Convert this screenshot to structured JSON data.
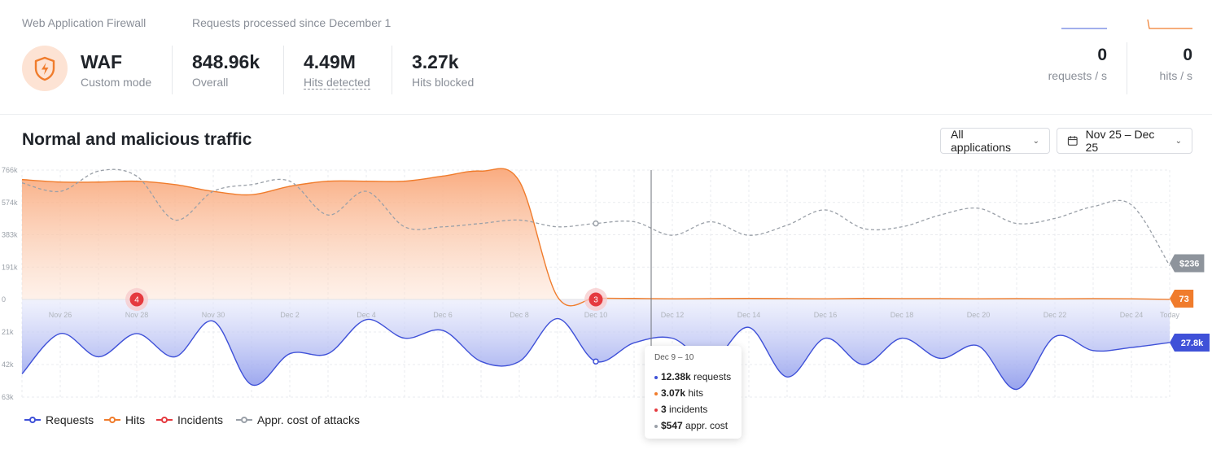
{
  "header": {
    "app_label": "Web Application Firewall",
    "since_label": "Requests processed since December 1",
    "waf_title": "WAF",
    "waf_mode": "Custom mode",
    "stats": [
      {
        "value": "848.96k",
        "label": "Overall"
      },
      {
        "value": "4.49M",
        "label": "Hits detected"
      },
      {
        "value": "3.27k",
        "label": "Hits blocked"
      }
    ],
    "live": [
      {
        "value": "0",
        "label": "requests / s"
      },
      {
        "value": "0",
        "label": "hits / s"
      }
    ]
  },
  "section": {
    "title": "Normal and malicious traffic",
    "app_filter": "All applications",
    "date_range": "Nov 25 – Dec 25"
  },
  "legend": [
    {
      "label": "Requests",
      "color": "#3f51d8"
    },
    {
      "label": "Hits",
      "color": "#f07c2c"
    },
    {
      "label": "Incidents",
      "color": "#e53a3f"
    },
    {
      "label": "Appr. cost of attacks",
      "color": "#9aa0a8"
    }
  ],
  "tooltip": {
    "title": "Dec 9 – 10",
    "rows": [
      {
        "bold": "12.38k",
        "text": " requests",
        "color": "#3f51d8"
      },
      {
        "bold": "3.07k",
        "text": " hits",
        "color": "#f07c2c"
      },
      {
        "bold": "3",
        "text": " incidents",
        "color": "#e53a3f"
      },
      {
        "bold": "$547",
        "text": " appr. cost",
        "color": "#9aa0a8"
      }
    ]
  },
  "chart_data": {
    "type": "area",
    "x": [
      "Nov 25",
      "Nov 26",
      "Nov 27",
      "Nov 28",
      "Nov 29",
      "Nov 30",
      "Dec 1",
      "Dec 2",
      "Dec 3",
      "Dec 4",
      "Dec 5",
      "Dec 6",
      "Dec 7",
      "Dec 8",
      "Dec 9",
      "Dec 10",
      "Dec 11",
      "Dec 12",
      "Dec 13",
      "Dec 14",
      "Dec 15",
      "Dec 16",
      "Dec 17",
      "Dec 18",
      "Dec 19",
      "Dec 20",
      "Dec 21",
      "Dec 22",
      "Dec 23",
      "Dec 24",
      "Dec 25"
    ],
    "x_tick_labels": [
      "Nov 26",
      "Nov 28",
      "Nov 30",
      "Dec 2",
      "Dec 4",
      "Dec 6",
      "Dec 8",
      "Dec 10",
      "Dec 12",
      "Dec 14",
      "Dec 16",
      "Dec 18",
      "Dec 20",
      "Dec 22",
      "Dec 24",
      "Today"
    ],
    "y_top_ticks": [
      "766k",
      "574k",
      "383k",
      "191k",
      "0"
    ],
    "y_bottom_ticks": [
      "21k",
      "42k",
      "63k"
    ],
    "top_ylim": [
      0,
      766000
    ],
    "bottom_ylim": [
      0,
      63000
    ],
    "series": [
      {
        "name": "Hits",
        "axis": "top",
        "values": [
          710000,
          695000,
          695000,
          700000,
          680000,
          640000,
          620000,
          670000,
          700000,
          700000,
          700000,
          730000,
          760000,
          700000,
          15000,
          8000,
          6000,
          4000,
          5000,
          6000,
          5000,
          4000,
          6000,
          5000,
          5000,
          4000,
          5000,
          4000,
          5000,
          4000,
          73
        ]
      },
      {
        "name": "Appr. cost of attacks",
        "axis": "top",
        "values": [
          690000,
          640000,
          760000,
          730000,
          470000,
          640000,
          680000,
          700000,
          500000,
          640000,
          430000,
          430000,
          450000,
          470000,
          430000,
          450000,
          460000,
          380000,
          460000,
          380000,
          440000,
          530000,
          420000,
          430000,
          500000,
          540000,
          450000,
          480000,
          550000,
          560000,
          200000
        ],
        "end_label": "$236"
      },
      {
        "name": "Requests",
        "axis": "bottom",
        "values": [
          48000,
          22000,
          37000,
          22000,
          37000,
          14000,
          55000,
          35000,
          35000,
          13000,
          25000,
          20000,
          40000,
          40000,
          12380,
          40000,
          28000,
          25000,
          40000,
          18000,
          50000,
          25000,
          42000,
          25000,
          38000,
          30000,
          58000,
          24000,
          33000,
          31000,
          27800
        ],
        "end_label": "27.8k"
      }
    ],
    "hits_end_label": "73",
    "incidents": [
      {
        "x": "Nov 28",
        "count": "4"
      },
      {
        "x": "Dec 10",
        "count": "3"
      }
    ],
    "highlight_x": "Dec 10"
  }
}
